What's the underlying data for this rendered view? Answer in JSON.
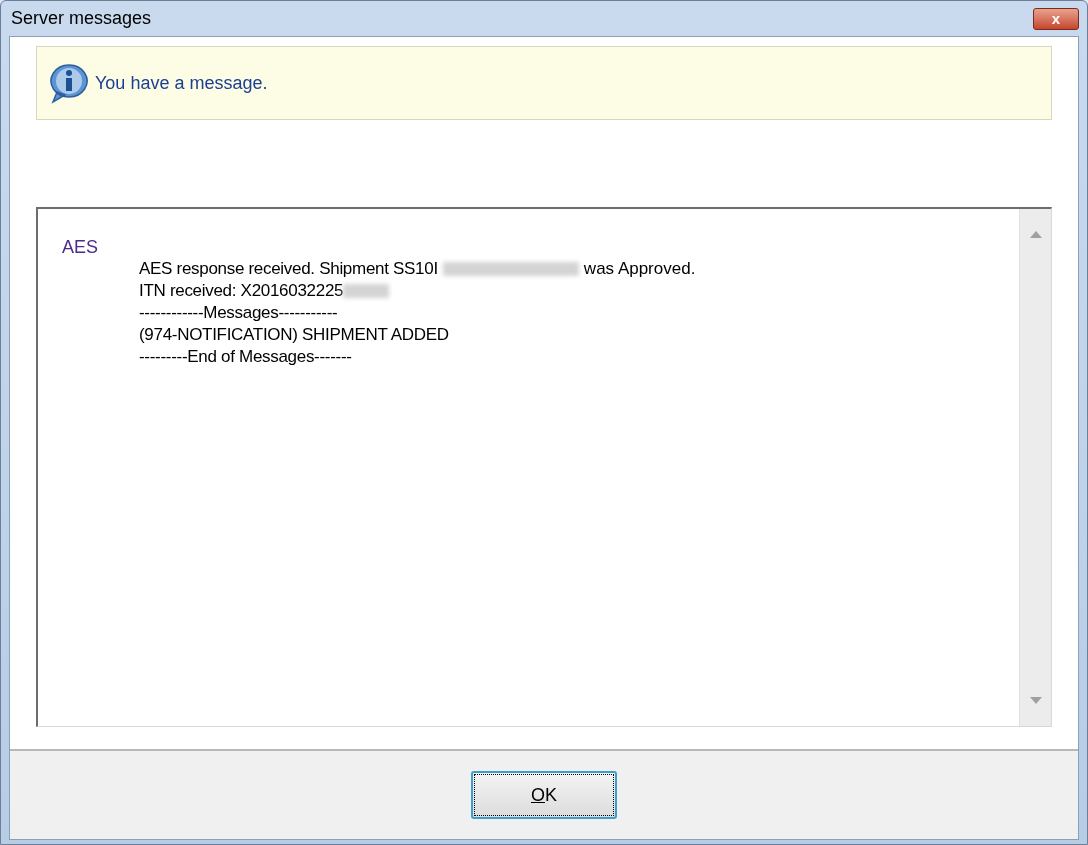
{
  "window": {
    "title": "Server messages",
    "close_label": "x"
  },
  "banner": {
    "text": "You have a message."
  },
  "message": {
    "source": "AES",
    "lines": [
      {
        "text": "AES response received. Shipment SS10I",
        "redacted": true,
        "after": "was Approved."
      },
      {
        "text": "ITN received: X2016032225",
        "redacted": true
      },
      {
        "text": "------------Messages-----------",
        "redacted": false
      },
      {
        "text": "(974-NOTIFICATION) SHIPMENT ADDED",
        "redacted": false
      },
      {
        "text": "---------End of Messages-------",
        "redacted": false
      }
    ]
  },
  "buttons": [
    {
      "label": "OK",
      "mnemonic_underlined": true,
      "focused": true
    }
  ]
}
